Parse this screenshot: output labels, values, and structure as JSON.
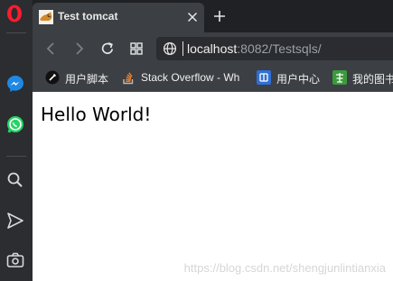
{
  "tab": {
    "title": "Test tomcat",
    "close_icon": "close-icon",
    "favicon": "tomcat-favicon-icon"
  },
  "new_tab_icon": "plus-icon",
  "toolbar": {
    "back_icon": "arrow-left-icon",
    "forward_icon": "arrow-right-icon",
    "reload_icon": "reload-icon",
    "tabs_grid_icon": "grid-icon",
    "address": {
      "host": "localhost",
      "rest": ":8082/Testsqls/"
    }
  },
  "bookmarks": [
    {
      "label": "用户脚本",
      "icon": "user-script-icon"
    },
    {
      "label": "Stack Overflow - Wh",
      "icon": "stackoverflow-icon"
    },
    {
      "label": "用户中心",
      "icon": "user-center-icon"
    },
    {
      "label": "我的图书",
      "icon": "library-icon"
    }
  ],
  "sidebar": {
    "logo": "opera-logo-icon",
    "items": [
      {
        "icon": "messenger-icon"
      },
      {
        "icon": "whatsapp-icon"
      },
      {
        "icon": "search-icon"
      },
      {
        "icon": "send-icon"
      },
      {
        "icon": "camera-icon"
      }
    ]
  },
  "page": {
    "heading": "Hello World!",
    "watermark": "https://blog.csdn.net/shengjunlintianxia"
  },
  "colors": {
    "sidebar": "#2b2d30",
    "tabstrip": "#202124",
    "toolbar": "#3c3f43",
    "opera_red": "#ff1b2d",
    "messenger_blue": "#1e88e5",
    "whatsapp_green": "#25d366"
  }
}
